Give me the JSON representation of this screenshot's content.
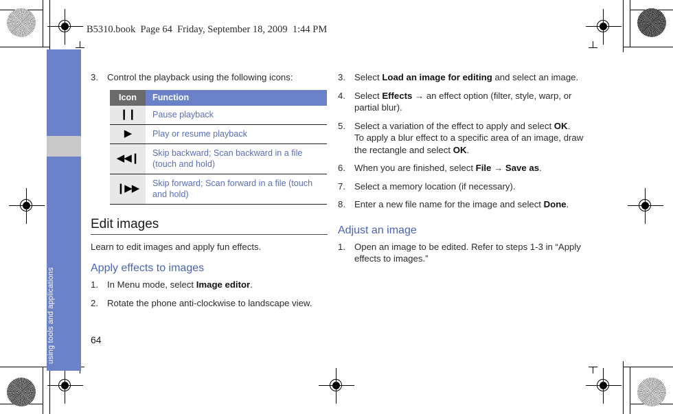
{
  "book_header": "B5310.book  Page 64  Friday, September 18, 2009  1:44 PM",
  "page_number": "64",
  "sidebar": {
    "label": "using tools and applications",
    "color": "#6b82c8",
    "band_color": "#c9c9c9"
  },
  "colors": {
    "accent_blue": "#6b82c8",
    "heading_blue": "#4a63b8",
    "table_text_blue": "#5a6fbe",
    "icon_header_gray": "#6b6b6b",
    "icon_cell_gray": "#e8e8e8",
    "body_text": "#2b2b2b"
  },
  "left_column": {
    "step3": {
      "num": "3.",
      "text": "Control the playback using the following icons:"
    },
    "table": {
      "headers": [
        "Icon",
        "Function"
      ],
      "rows": [
        {
          "icon": "pause-icon",
          "glyph": "❙❙",
          "function": "Pause playback"
        },
        {
          "icon": "play-icon",
          "glyph": "▶",
          "function": "Play or resume playback"
        },
        {
          "icon": "skip-backward-icon",
          "glyph": "◀◀❙",
          "function": "Skip backward; Scan backward in a file (touch and hold)"
        },
        {
          "icon": "skip-forward-icon",
          "glyph": "❙▶▶",
          "function": "Skip forward; Scan forward in a file (touch and hold)"
        }
      ]
    },
    "heading_main": "Edit images",
    "intro": "Learn to edit images and apply fun effects.",
    "heading_sub": "Apply effects to images",
    "steps": [
      {
        "num": "1.",
        "pre": "In Menu mode, select ",
        "bold": "Image editor",
        "post": "."
      },
      {
        "num": "2.",
        "pre": "Rotate the phone anti-clockwise to landscape view.",
        "bold": "",
        "post": ""
      }
    ]
  },
  "right_column": {
    "steps": [
      {
        "num": "3.",
        "parts": [
          {
            "t": "Select ",
            "b": false
          },
          {
            "t": "Load an image for  editing",
            "b": true
          },
          {
            "t": " and select an image.",
            "b": false
          }
        ]
      },
      {
        "num": "4.",
        "parts": [
          {
            "t": "Select ",
            "b": false
          },
          {
            "t": "Effects",
            "b": true
          },
          {
            "t": " → an effect option (filter, style, warp, or partial blur).",
            "b": false
          }
        ]
      },
      {
        "num": "5.",
        "parts": [
          {
            "t": "Select a variation of the effect to apply and select ",
            "b": false
          },
          {
            "t": "OK",
            "b": true
          },
          {
            "t": ".",
            "b": false
          }
        ],
        "extra_parts": [
          {
            "t": "To apply a blur effect to a specific area of an image, draw the rectangle and select ",
            "b": false
          },
          {
            "t": "OK",
            "b": true
          },
          {
            "t": ".",
            "b": false
          }
        ]
      },
      {
        "num": "6.",
        "parts": [
          {
            "t": "When you are finished, select ",
            "b": false
          },
          {
            "t": "File",
            "b": true
          },
          {
            "t": " → ",
            "b": false
          },
          {
            "t": "Save as",
            "b": true
          },
          {
            "t": ".",
            "b": false
          }
        ]
      },
      {
        "num": "7.",
        "parts": [
          {
            "t": "Select a memory location (if necessary).",
            "b": false
          }
        ]
      },
      {
        "num": "8.",
        "parts": [
          {
            "t": "Enter a new file name for the image and select ",
            "b": false
          },
          {
            "t": "Done",
            "b": true
          },
          {
            "t": ".",
            "b": false
          }
        ]
      }
    ],
    "heading_sub": "Adjust an image",
    "steps2": [
      {
        "num": "1.",
        "parts": [
          {
            "t": "Open an image to be edited. Refer to steps 1-3 in “Apply effects to images.”",
            "b": false
          }
        ]
      }
    ]
  }
}
